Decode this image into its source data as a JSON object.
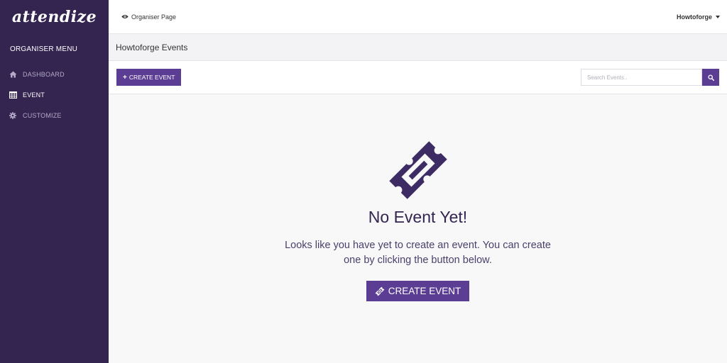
{
  "brand": {
    "logo_text": "attendize"
  },
  "sidebar": {
    "heading": "ORGANISER MENU",
    "items": [
      {
        "label": "DASHBOARD",
        "icon": "home-icon",
        "active": false
      },
      {
        "label": "EVENT",
        "icon": "calendar-icon",
        "active": true
      },
      {
        "label": "CUSTOMIZE",
        "icon": "gear-icon",
        "active": false
      }
    ]
  },
  "topbar": {
    "organiser_link": "Organiser Page",
    "user_name": "Howtoforge"
  },
  "page_header": {
    "title": "Howtoforge Events"
  },
  "toolbar": {
    "create_label": "CREATE EVENT",
    "search_placeholder": "Search Events.."
  },
  "empty_state": {
    "title": "No Event Yet!",
    "message": "Looks like you have yet to create an event. You can create one by clicking the button below.",
    "button_label": "CREATE EVENT"
  },
  "colors": {
    "sidebar_bg": "#33254f",
    "accent": "#5c3d94",
    "icon_dark": "#3d2b63"
  }
}
